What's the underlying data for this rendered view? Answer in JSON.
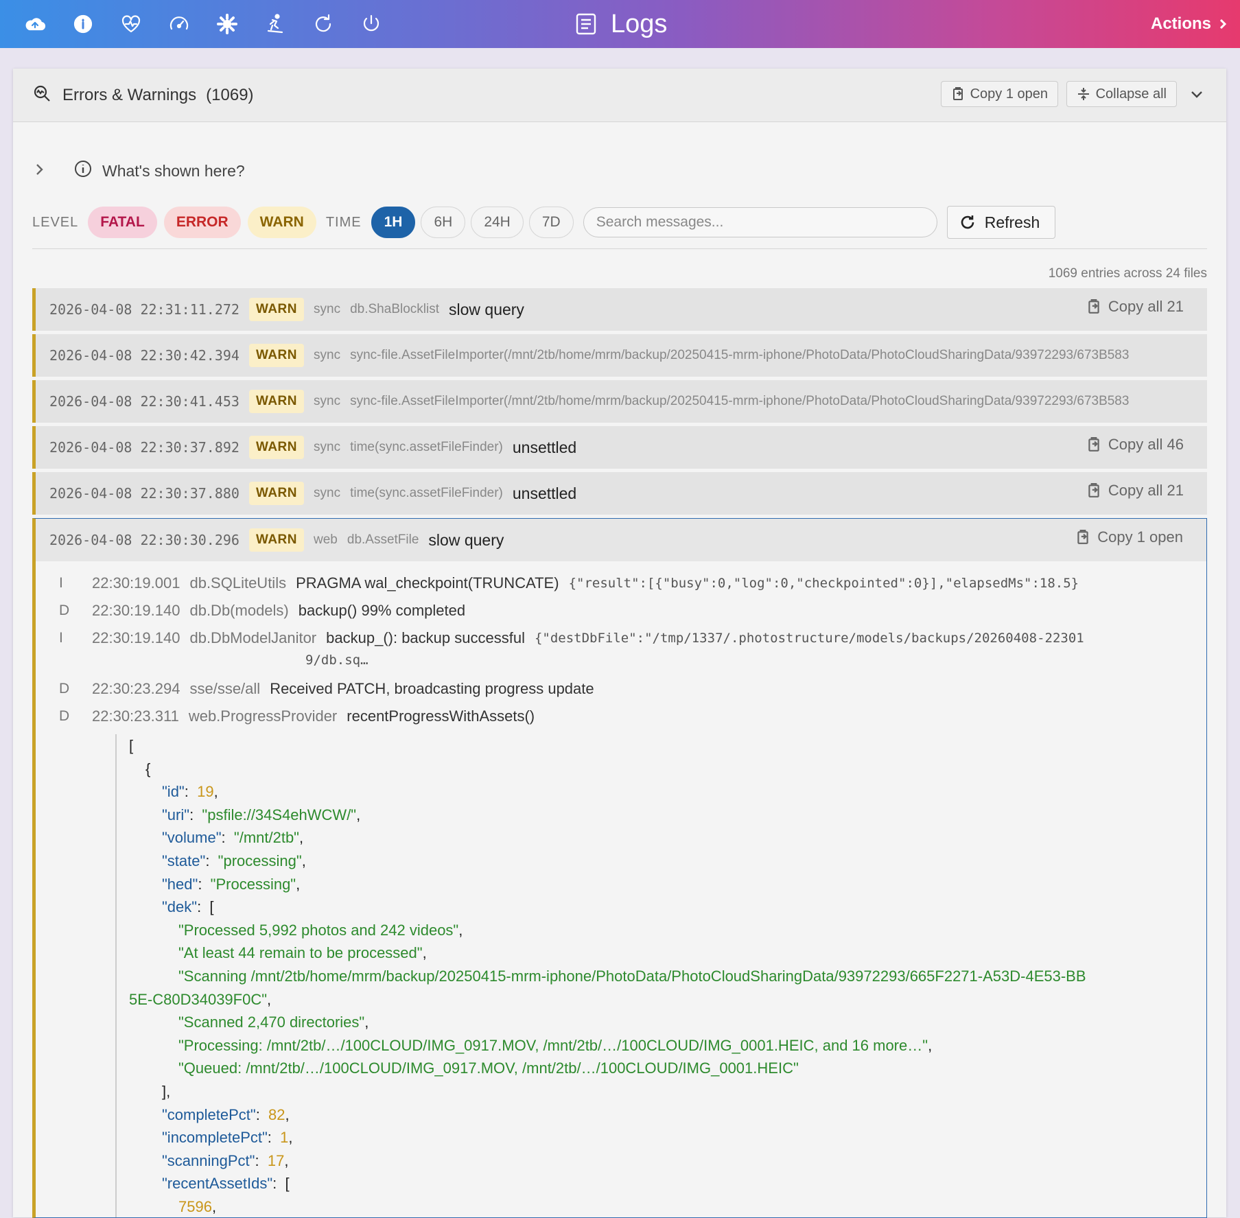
{
  "header": {
    "title": "Logs",
    "actions_label": "Actions",
    "icons": [
      "cloud-icon",
      "info-icon",
      "heart-pulse-icon",
      "speedometer-icon",
      "gear-icon",
      "skier-icon",
      "reload-icon",
      "power-icon"
    ]
  },
  "panel": {
    "title": "Errors & Warnings",
    "count": "(1069)",
    "copy_open_label": "Copy 1 open",
    "collapse_all_label": "Collapse all",
    "whats_shown": "What's shown here?"
  },
  "filters": {
    "level_label": "LEVEL",
    "levels": [
      "FATAL",
      "ERROR",
      "WARN"
    ],
    "time_label": "TIME",
    "times": [
      "1H",
      "6H",
      "24H",
      "7D"
    ],
    "active_time": "1H",
    "search_placeholder": "Search messages...",
    "refresh_label": "Refresh"
  },
  "summary": "1069 entries across 24 files",
  "rows": [
    {
      "ts": "2026-04-08 22:31:11.272",
      "level": "WARN",
      "src": "sync",
      "ctx": "db.ShaBlocklist",
      "msg": "slow query",
      "copy": "Copy all 21"
    },
    {
      "ts": "2026-04-08 22:30:42.394",
      "level": "WARN",
      "src": "sync",
      "ctx": "sync-file.AssetFileImporter(/mnt/2tb/home/mrm/backup/20250415-mrm-iphone/PhotoData/PhotoCloudSharingData/93972293/673B583",
      "msg": "",
      "copy": ""
    },
    {
      "ts": "2026-04-08 22:30:41.453",
      "level": "WARN",
      "src": "sync",
      "ctx": "sync-file.AssetFileImporter(/mnt/2tb/home/mrm/backup/20250415-mrm-iphone/PhotoData/PhotoCloudSharingData/93972293/673B583",
      "msg": "",
      "copy": ""
    },
    {
      "ts": "2026-04-08 22:30:37.892",
      "level": "WARN",
      "src": "sync",
      "ctx": "time(sync.assetFileFinder)",
      "msg": "unsettled",
      "copy": "Copy all 46"
    },
    {
      "ts": "2026-04-08 22:30:37.880",
      "level": "WARN",
      "src": "sync",
      "ctx": "time(sync.assetFileFinder)",
      "msg": "unsettled",
      "copy": "Copy all 21"
    }
  ],
  "expanded": {
    "ts": "2026-04-08 22:30:30.296",
    "level": "WARN",
    "src": "web",
    "ctx": "db.AssetFile",
    "msg": "slow query",
    "copy": "Copy 1 open",
    "lines": [
      {
        "lvl": "I",
        "ts": "22:30:19.001",
        "ctx": "db.SQLiteUtils",
        "msg": "PRAGMA wal_checkpoint(TRUNCATE)",
        "json": "{\"result\":[{\"busy\":0,\"log\":0,\"checkpointed\":0}],\"elapsedMs\":18.5}"
      },
      {
        "lvl": "D",
        "ts": "22:30:19.140",
        "ctx": "db.Db(models)",
        "msg": "backup() 99% completed",
        "json": ""
      },
      {
        "lvl": "I",
        "ts": "22:30:19.140",
        "ctx": "db.DbModelJanitor",
        "msg": "backup_(): backup successful",
        "json": "{\"destDbFile\":\"/tmp/1337/.photostructure/models/backups/20260408-22301",
        "json2": "9/db.sq…"
      },
      {
        "lvl": "D",
        "ts": "22:30:23.294",
        "ctx": "sse/sse/all",
        "msg": "Received PATCH, broadcasting progress update",
        "json": ""
      },
      {
        "lvl": "D",
        "ts": "22:30:23.311",
        "ctx": "web.ProgressProvider",
        "msg": "recentProgressWithAssets()",
        "json": ""
      }
    ],
    "json": {
      "id": "19",
      "uri": "\"psfile://34S4ehWCW/\"",
      "volume": "\"/mnt/2tb\"",
      "state": "\"processing\"",
      "hed": "\"Processing\"",
      "dek": [
        "\"Processed 5,992 photos and 242 videos\"",
        "\"At least 44 remain to be processed\"",
        "\"Scanning /mnt/2tb/home/mrm/backup/20250415-mrm-iphone/PhotoData/PhotoCloudSharingData/93972293/665F2271-A53D-4E53-BB",
        "5E-C80D34039F0C\"",
        "\"Scanned 2,470 directories\"",
        "\"Processing: /mnt/2tb/…/100CLOUD/IMG_0917.MOV, /mnt/2tb/…/100CLOUD/IMG_0001.HEIC, and 16 more…\"",
        "\"Queued: /mnt/2tb/…/100CLOUD/IMG_0917.MOV, /mnt/2tb/…/100CLOUD/IMG_0001.HEIC\""
      ],
      "completePct": "82",
      "incompletePct": "1",
      "scanningPct": "17",
      "recentAssetIds_first": "7596"
    },
    "keys": {
      "id": "\"id\"",
      "uri": "\"uri\"",
      "volume": "\"volume\"",
      "state": "\"state\"",
      "hed": "\"hed\"",
      "dek": "\"dek\"",
      "completePct": "\"completePct\"",
      "incompletePct": "\"incompletePct\"",
      "scanningPct": "\"scanningPct\"",
      "recentAssetIds": "\"recentAssetIds\""
    }
  }
}
